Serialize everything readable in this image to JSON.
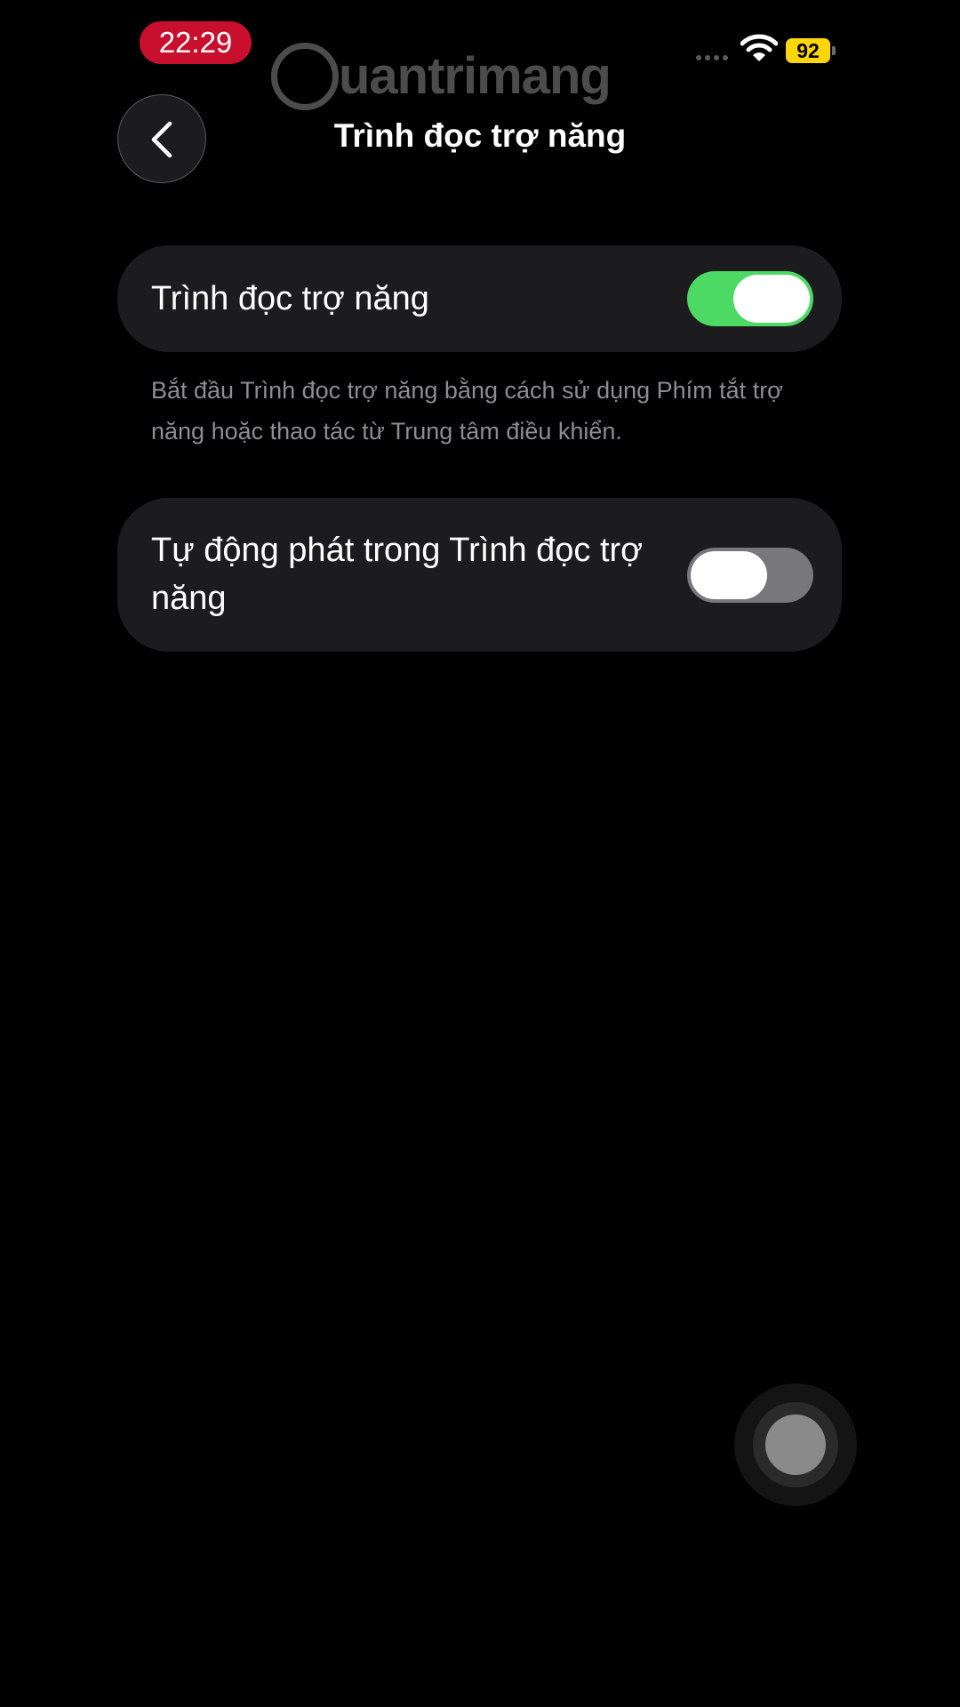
{
  "status_bar": {
    "time": "22:29",
    "battery_level": "92",
    "time_pill_color": "#c8102e",
    "battery_color": "#ffd60a",
    "icons": [
      "cell-signal-icon",
      "wifi-icon",
      "battery-icon"
    ]
  },
  "watermark": {
    "text": "uantrimang"
  },
  "nav": {
    "back_icon": "chevron-left-icon",
    "title": "Trình đọc trợ năng"
  },
  "settings": [
    {
      "label": "Trình đọc trợ năng",
      "enabled": true
    },
    {
      "label": "Tự động phát trong Trình đọc trợ năng",
      "enabled": false
    }
  ],
  "footnote": "Bắt đầu Trình đọc trợ năng bằng cách sử dụng Phím tắt trợ năng hoặc thao tác từ Trung tâm điều khiển.",
  "colors": {
    "toggle_on": "#4cd964",
    "toggle_off": "#78787c",
    "card_background": "#1c1c1e"
  },
  "assistive_touch_icon": "assistive-touch-icon"
}
